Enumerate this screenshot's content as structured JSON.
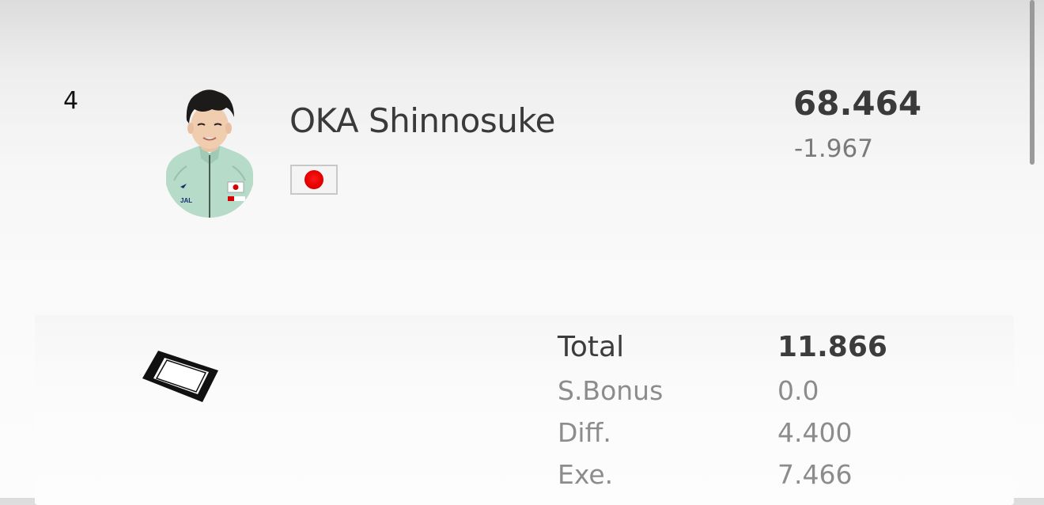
{
  "result": {
    "rank": "4",
    "athlete_name": "OKA Shinnosuke",
    "country_flag_icon": "japan-flag-icon",
    "total_score": "68.464",
    "score_difference": "-1.967"
  },
  "apparatus": {
    "icon": "floor-apparatus-icon"
  },
  "breakdown": {
    "total_label": "Total",
    "total_value": "11.866",
    "bonus_label": "S.Bonus",
    "bonus_value": "0.0",
    "difficulty_label": "Diff.",
    "difficulty_value": "4.400",
    "execution_label": "Exe.",
    "execution_value": "7.466"
  },
  "colors": {
    "primary_text": "#3a3a3a",
    "secondary_text": "#8c8c8c",
    "flag_red": "#e60000"
  }
}
